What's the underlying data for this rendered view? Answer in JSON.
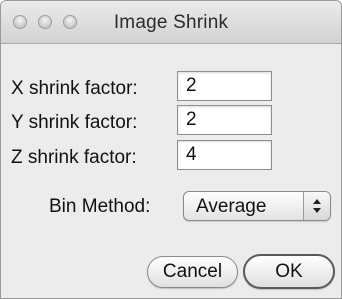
{
  "window": {
    "title": "Image Shrink"
  },
  "form": {
    "x": {
      "label": "X shrink factor:",
      "value": "2"
    },
    "y": {
      "label": "Y shrink factor:",
      "value": "2"
    },
    "z": {
      "label": "Z shrink factor:",
      "value": "4"
    },
    "bin_method": {
      "label": "Bin Method:",
      "selected": "Average"
    }
  },
  "buttons": {
    "cancel": "Cancel",
    "ok": "OK"
  },
  "icons": {
    "close": "close-traffic-light-icon",
    "minimize": "minimize-traffic-light-icon",
    "zoom": "zoom-traffic-light-icon",
    "select_arrows": "up-down-arrows-icon"
  }
}
